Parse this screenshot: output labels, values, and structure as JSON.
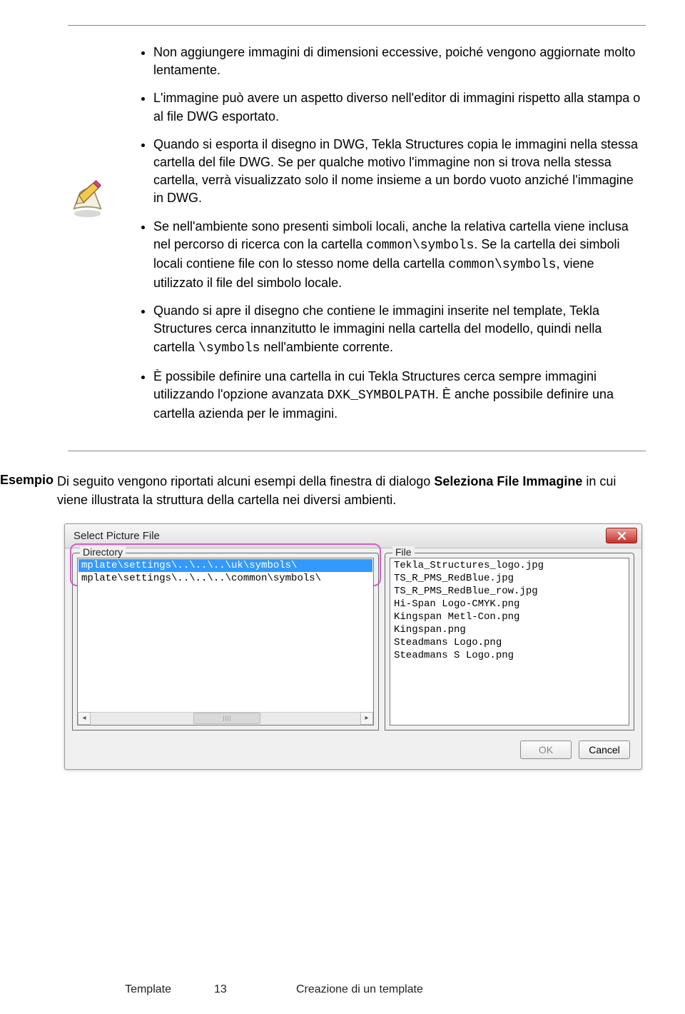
{
  "bullets": {
    "b1": "Non aggiungere immagini di dimensioni eccessive, poiché vengono aggiornate molto lentamente.",
    "b2": "L'immagine può avere un aspetto diverso nell'editor di immagini rispetto alla stampa o al file DWG esportato.",
    "b3": "Quando si esporta il disegno in DWG, Tekla Structures copia le immagini nella stessa cartella del file DWG. Se per qualche motivo l'immagine non si trova nella stessa cartella, verrà visualizzato solo il nome insieme a un bordo vuoto anziché l'immagine in DWG.",
    "b4a": "Se nell'ambiente sono presenti simboli locali, anche la relativa cartella viene inclusa nel percorso di ricerca con la cartella ",
    "b4_code1": "common\\symbols",
    "b4b": ". Se la cartella dei simboli locali contiene file con lo stesso nome della cartella ",
    "b4_code2": "common\\symbols",
    "b4c": ", viene utilizzato il file del simbolo locale.",
    "b5a": "Quando si apre il disegno che contiene le immagini inserite nel template, Tekla Structures cerca innanzitutto le immagini nella cartella del modello, quindi nella cartella ",
    "b5_code": "\\symbols",
    "b5b": " nell'ambiente corrente.",
    "b6a": "È possibile definire una cartella in cui Tekla Structures cerca sempre immagini utilizzando l'opzione avanzata ",
    "b6_code": "DXK_SYMBOLPATH",
    "b6b": ". È anche possibile definire una cartella azienda per le immagini."
  },
  "esempio": {
    "label": "Esempio",
    "text_a": "Di seguito vengono riportati alcuni esempi della finestra di dialogo ",
    "bold": "Seleziona File Immagine",
    "text_b": " in cui viene illustrata la struttura della cartella nei diversi ambienti."
  },
  "dialog": {
    "title": "Select Picture File",
    "directory_label": "Directory",
    "file_label": "File",
    "directories": [
      "mplate\\settings\\..\\..\\..\\uk\\symbols\\",
      "mplate\\settings\\..\\..\\..\\common\\symbols\\"
    ],
    "files": [
      "Tekla_Structures_logo.jpg",
      "TS_R_PMS_RedBlue.jpg",
      "TS_R_PMS_RedBlue_row.jpg",
      "Hi-Span Logo-CMYK.png",
      "Kingspan Metl-Con.png",
      "Kingspan.png",
      "Steadmans Logo.png",
      "Steadmans S Logo.png"
    ],
    "ok": "OK",
    "cancel": "Cancel"
  },
  "footer": {
    "left": "Template",
    "page": "13",
    "right": "Creazione di un template"
  }
}
